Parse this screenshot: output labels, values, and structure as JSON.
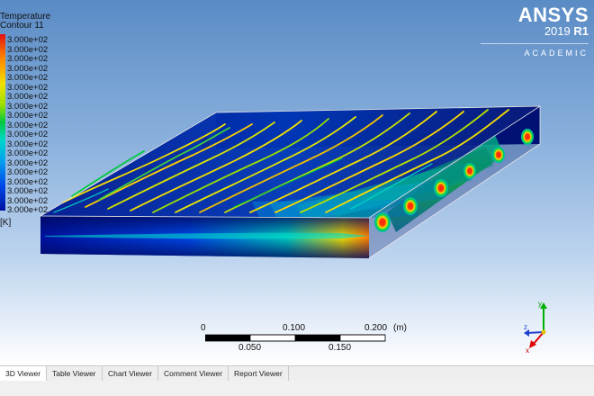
{
  "legend": {
    "title_line1": "Temperature",
    "title_line2": "Contour 11",
    "tick_value": "3.000e+02",
    "tick_count": 19,
    "unit": "[K]",
    "colors": [
      "#e01010",
      "#ff7a00",
      "#f3e000",
      "#00c840",
      "#00d8c8",
      "#00a0f0",
      "#0048e8",
      "#0010a0"
    ]
  },
  "brand": {
    "name": "ANSYS",
    "version_prefix": "2019 ",
    "version_suffix": "R1",
    "edition": "ACADEMIC"
  },
  "scale": {
    "top_labels": [
      "0",
      "0.100",
      "0.200"
    ],
    "bottom_labels": [
      "0.050",
      "0.150"
    ],
    "unit": "(m)"
  },
  "triad": {
    "x": "x",
    "y": "y",
    "z": "z"
  },
  "tabs": [
    {
      "label": "3D Viewer",
      "active": true
    },
    {
      "label": "Table Viewer",
      "active": false
    },
    {
      "label": "Chart Viewer",
      "active": false
    },
    {
      "label": "Comment Viewer",
      "active": false
    },
    {
      "label": "Report Viewer",
      "active": false
    }
  ]
}
